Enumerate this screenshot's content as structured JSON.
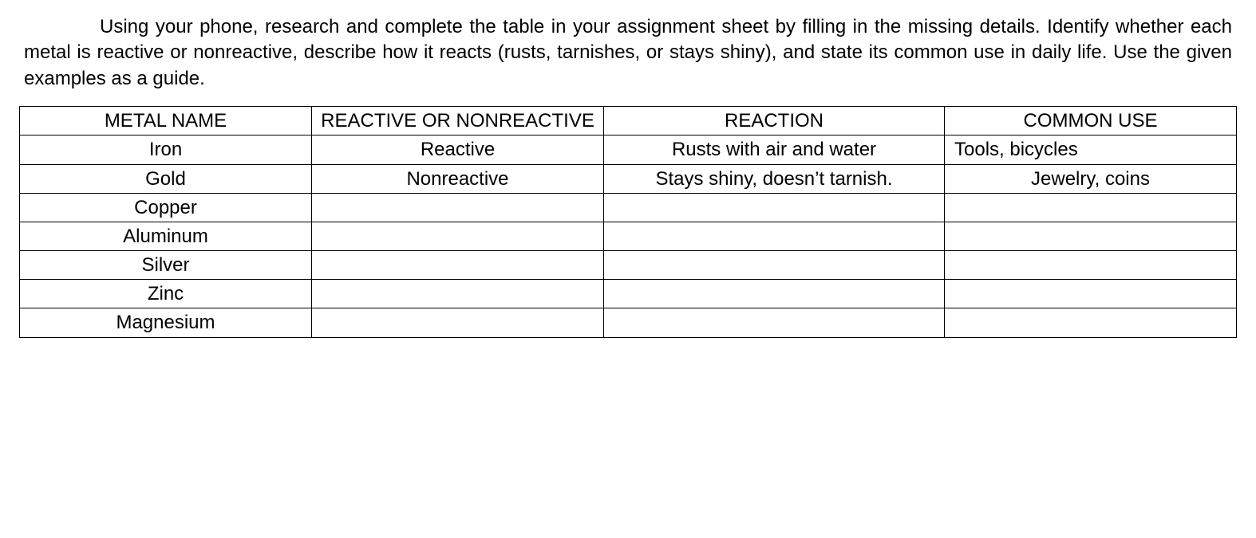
{
  "instructions": "Using your phone, research and complete the table in your assignment sheet by filling in the missing details. Identify whether each metal is reactive or nonreactive, describe how it reacts (rusts, tarnishes, or stays shiny), and state its common use in daily life. Use the given examples as a guide.",
  "table": {
    "headers": {
      "metal": "METAL NAME",
      "reactive": "REACTIVE OR NONREACTIVE",
      "reaction": "REACTION",
      "use": "COMMON USE"
    },
    "rows": [
      {
        "metal": "Iron",
        "reactive": "Reactive",
        "reaction": "Rusts with air and water",
        "use": "Tools, bicycles",
        "use_align": "left",
        "empty": false
      },
      {
        "metal": "Gold",
        "reactive": "Nonreactive",
        "reaction": "Stays shiny, doesn’t tarnish.",
        "use": "Jewelry, coins",
        "use_align": "center",
        "empty": false
      },
      {
        "metal": "Copper",
        "reactive": "",
        "reaction": "",
        "use": "",
        "use_align": "center",
        "empty": true
      },
      {
        "metal": "Aluminum",
        "reactive": "",
        "reaction": "",
        "use": "",
        "use_align": "center",
        "empty": true
      },
      {
        "metal": "Silver",
        "reactive": "",
        "reaction": "",
        "use": "",
        "use_align": "center",
        "empty": true
      },
      {
        "metal": "Zinc",
        "reactive": "",
        "reaction": "",
        "use": "",
        "use_align": "center",
        "empty": true
      },
      {
        "metal": "Magnesium",
        "reactive": "",
        "reaction": "",
        "use": "",
        "use_align": "center",
        "empty": true
      }
    ]
  }
}
